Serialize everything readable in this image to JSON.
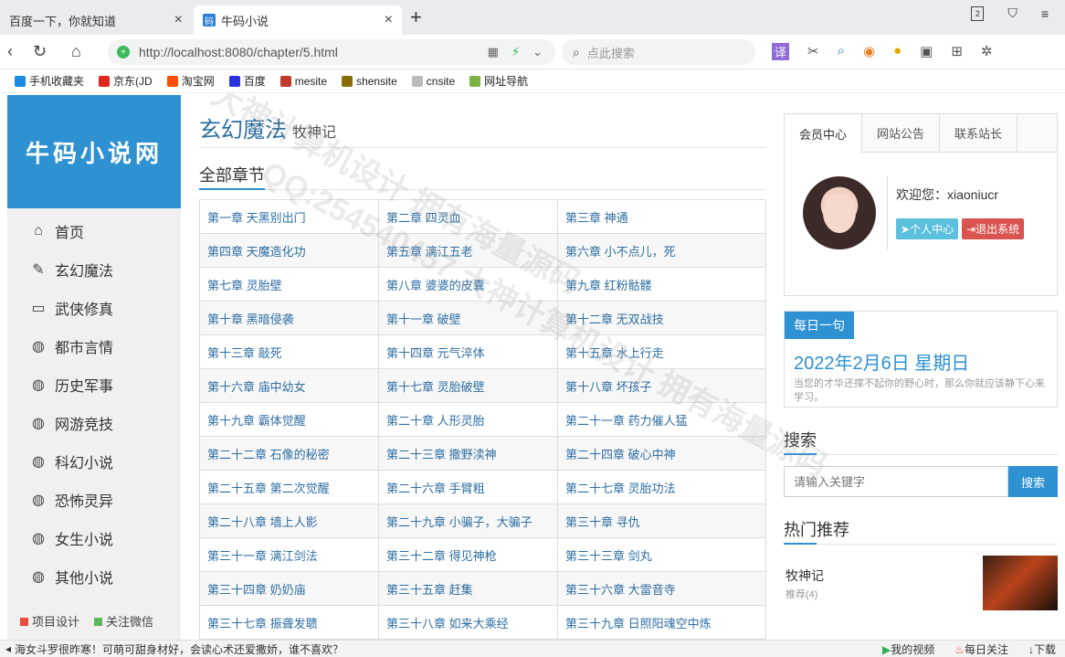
{
  "browser": {
    "tabs": [
      {
        "title": "百度一下，你就知道",
        "close": "×"
      },
      {
        "title": "牛码小说",
        "favicon": "码",
        "close": "×"
      }
    ],
    "new_tab": "+",
    "url_host": "http://localhost",
    "url_rest": ":8080/chapter/5.html",
    "search_placeholder": "点此搜索",
    "translate_label": "译",
    "window_number": "2",
    "bookmarks": [
      {
        "label": "手机收藏夹",
        "icon": "phone-icon",
        "color": "#1e88e5"
      },
      {
        "label": "京东(JD",
        "icon": "jd-icon",
        "color": "#e1251b"
      },
      {
        "label": "淘宝网",
        "icon": "taobao-icon",
        "color": "#ff5000"
      },
      {
        "label": "百度",
        "icon": "baidu-icon",
        "color": "#2932e1"
      },
      {
        "label": "mesite",
        "icon": "mesite-icon",
        "color": "#c0392b"
      },
      {
        "label": "shensite",
        "icon": "shensite-icon",
        "color": "#8a6d00"
      },
      {
        "label": "cnsite",
        "icon": "page-icon",
        "color": "#bbbbbb"
      },
      {
        "label": "网址导航",
        "icon": "nav-icon",
        "color": "#7cb342"
      }
    ]
  },
  "site": {
    "logo": "牛码小说网",
    "nav": [
      {
        "label": "首页",
        "icon": "home-icon"
      },
      {
        "label": "玄幻魔法",
        "icon": "eraser-icon"
      },
      {
        "label": "武侠修真",
        "icon": "inbox-icon"
      },
      {
        "label": "都市言情",
        "icon": "globe-icon"
      },
      {
        "label": "历史军事",
        "icon": "globe-icon"
      },
      {
        "label": "网游竞技",
        "icon": "globe-icon"
      },
      {
        "label": "科幻小说",
        "icon": "globe-icon"
      },
      {
        "label": "恐怖灵异",
        "icon": "globe-icon"
      },
      {
        "label": "女生小说",
        "icon": "globe-icon"
      },
      {
        "label": "其他小说",
        "icon": "globe-icon"
      }
    ],
    "footer": [
      {
        "label": "项目设计",
        "color": "#e74c3c"
      },
      {
        "label": "关注微信",
        "color": "#5cb85c"
      }
    ]
  },
  "book": {
    "category": "玄幻魔法",
    "name": "牧神记",
    "section_title": "全部章节",
    "chapters": [
      "第一章 天黑别出门",
      "第二章 四灵血",
      "第三章 神通",
      "第四章 天魔造化功",
      "第五章 漓江五老",
      "第六章 小不点儿，死",
      "第七章 灵胎壁",
      "第八章 婆婆的皮囊",
      "第九章 红粉骷髅",
      "第十章 黑暗侵袭",
      "第十一章 破壁",
      "第十二章 无双战技",
      "第十三章 敲死",
      "第十四章 元气淬体",
      "第十五章 水上行走",
      "第十六章 庙中幼女",
      "第十七章 灵胎破壁",
      "第十八章 坏孩子",
      "第十九章 霸体觉醒",
      "第二十章 人形灵胎",
      "第二十一章 药力催人猛",
      "第二十二章 石像的秘密",
      "第二十三章 撒野渎神",
      "第二十四章 破心中神",
      "第二十五章 第二次觉醒",
      "第二十六章 手臂粗",
      "第二十七章 灵胎功法",
      "第二十八章 墙上人影",
      "第二十九章 小骗子，大骗子",
      "第三十章 寻仇",
      "第三十一章 漓江剑法",
      "第三十二章 得见神枪",
      "第三十三章 剑丸",
      "第三十四章 奶奶庙",
      "第三十五章 赶集",
      "第三十六章 大雷音寺",
      "第三十七章 振聋发聩",
      "第三十八章 如来大乘经",
      "第三十九章 日照阳魂空中炼"
    ]
  },
  "sidebar_right": {
    "tabs": [
      "会员中心",
      "网站公告",
      "联系站长"
    ],
    "welcome": "欢迎您：xiaoniucr",
    "btn_profile": "个人中心",
    "btn_logout": "退出系统",
    "daily_tag": "每日一句",
    "daily_date": "2022年2月6日 星期日",
    "daily_quote": "当您的才华还撑不起你的野心时，那么你就应该静下心来学习。",
    "search_title": "搜索",
    "search_placeholder": "请输入关键字",
    "search_button": "搜索",
    "hot_title": "热门推荐",
    "hot_book": "牧神记",
    "hot_sub": "推荐(4)"
  },
  "statusbar": {
    "news": "海女斗罗很昨寒！可萌可甜身材好，会读心术还爱撒娇，谁不喜欢？",
    "video": "我的视频",
    "daily": "每日关注",
    "download": "下载"
  },
  "watermark": "QQ:254540457 大神计算机设计 拥有海量源码"
}
